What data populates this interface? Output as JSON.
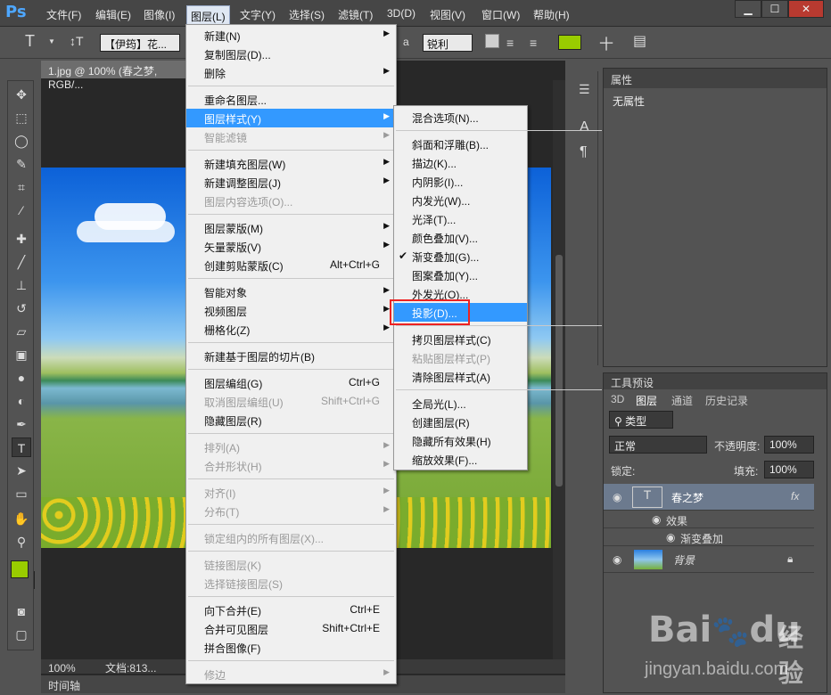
{
  "app": {
    "logo": "Ps"
  },
  "menubar": {
    "items": [
      "文件(F)",
      "编辑(E)",
      "图像(I)",
      "图层(L)",
      "文字(Y)",
      "选择(S)",
      "滤镜(T)",
      "3D(D)",
      "视图(V)",
      "窗口(W)",
      "帮助(H)"
    ],
    "active_index": 3
  },
  "window_controls": {
    "minimize": "▁",
    "maximize": "☐",
    "close": "✕"
  },
  "optbar": {
    "text_tool": "T",
    "font_name": "【伊筠】花...",
    "aa_label": "a",
    "aa_value": "锐利",
    "text_color": "#99cc00"
  },
  "document": {
    "tab_title": "1.jpg @ 100% (春之梦, RGB/...",
    "zoom": "100%",
    "doc_info": "文档:813..."
  },
  "timeline": {
    "label": "时间轴"
  },
  "layer_menu": {
    "items": [
      {
        "label": "新建(N)",
        "arrow": true
      },
      {
        "label": "复制图层(D)..."
      },
      {
        "label": "删除",
        "arrow": true
      },
      {
        "sep": true
      },
      {
        "label": "重命名图层..."
      },
      {
        "label": "图层样式(Y)",
        "arrow": true,
        "highlight": true
      },
      {
        "label": "智能滤镜",
        "arrow": true,
        "disabled": true
      },
      {
        "sep": true
      },
      {
        "label": "新建填充图层(W)",
        "arrow": true
      },
      {
        "label": "新建调整图层(J)",
        "arrow": true
      },
      {
        "label": "图层内容选项(O)...",
        "disabled": true
      },
      {
        "sep": true
      },
      {
        "label": "图层蒙版(M)",
        "arrow": true
      },
      {
        "label": "矢量蒙版(V)",
        "arrow": true
      },
      {
        "label": "创建剪贴蒙版(C)",
        "shortcut": "Alt+Ctrl+G"
      },
      {
        "sep": true
      },
      {
        "label": "智能对象",
        "arrow": true
      },
      {
        "label": "视频图层",
        "arrow": true
      },
      {
        "label": "栅格化(Z)",
        "arrow": true
      },
      {
        "sep": true
      },
      {
        "label": "新建基于图层的切片(B)"
      },
      {
        "sep": true
      },
      {
        "label": "图层编组(G)",
        "shortcut": "Ctrl+G"
      },
      {
        "label": "取消图层编组(U)",
        "shortcut": "Shift+Ctrl+G",
        "disabled": true
      },
      {
        "label": "隐藏图层(R)"
      },
      {
        "sep": true
      },
      {
        "label": "排列(A)",
        "arrow": true,
        "disabled": true
      },
      {
        "label": "合并形状(H)",
        "arrow": true,
        "disabled": true
      },
      {
        "sep": true
      },
      {
        "label": "对齐(I)",
        "arrow": true,
        "disabled": true
      },
      {
        "label": "分布(T)",
        "arrow": true,
        "disabled": true
      },
      {
        "sep": true
      },
      {
        "label": "锁定组内的所有图层(X)...",
        "disabled": true
      },
      {
        "sep": true
      },
      {
        "label": "链接图层(K)",
        "disabled": true
      },
      {
        "label": "选择链接图层(S)",
        "disabled": true
      },
      {
        "sep": true
      },
      {
        "label": "向下合并(E)",
        "shortcut": "Ctrl+E"
      },
      {
        "label": "合并可见图层",
        "shortcut": "Shift+Ctrl+E"
      },
      {
        "label": "拼合图像(F)"
      },
      {
        "sep": true
      },
      {
        "label": "修边",
        "arrow": true,
        "disabled": true
      }
    ]
  },
  "style_submenu": {
    "items": [
      {
        "label": "混合选项(N)..."
      },
      {
        "sep": true
      },
      {
        "label": "斜面和浮雕(B)..."
      },
      {
        "label": "描边(K)..."
      },
      {
        "label": "内阴影(I)..."
      },
      {
        "label": "内发光(W)..."
      },
      {
        "label": "光泽(T)..."
      },
      {
        "label": "颜色叠加(V)..."
      },
      {
        "label": "渐变叠加(G)...",
        "checked": true
      },
      {
        "label": "图案叠加(Y)..."
      },
      {
        "label": "外发光(O)..."
      },
      {
        "label": "投影(D)...",
        "highlight": true
      },
      {
        "sep": true
      },
      {
        "label": "拷贝图层样式(C)"
      },
      {
        "label": "粘贴图层样式(P)",
        "disabled": true
      },
      {
        "label": "清除图层样式(A)"
      },
      {
        "sep": true
      },
      {
        "label": "全局光(L)..."
      },
      {
        "label": "创建图层(R)"
      },
      {
        "label": "隐藏所有效果(H)"
      },
      {
        "label": "缩放效果(F)..."
      }
    ]
  },
  "props_panel": {
    "tab": "属性",
    "body": "无属性"
  },
  "layers_panel": {
    "header": "工具预设",
    "tabs": [
      "3D",
      "图层",
      "通道",
      "历史记录"
    ],
    "active_tab": 1,
    "filter": "类型",
    "blend_mode": "正常",
    "opacity_label": "不透明度:",
    "opacity_value": "100%",
    "lock_label": "锁定:",
    "fill_label": "填充:",
    "fill_value": "100%",
    "layers": [
      {
        "name": "春之梦",
        "thumb": "T",
        "fx": "fx"
      },
      {
        "name": "效果"
      },
      {
        "name": "渐变叠加"
      },
      {
        "name": "背景"
      }
    ]
  },
  "watermark": {
    "brand": "Bai",
    "brand2": "du",
    "cn": "经验",
    "url": "jingyan.baidu.com"
  }
}
